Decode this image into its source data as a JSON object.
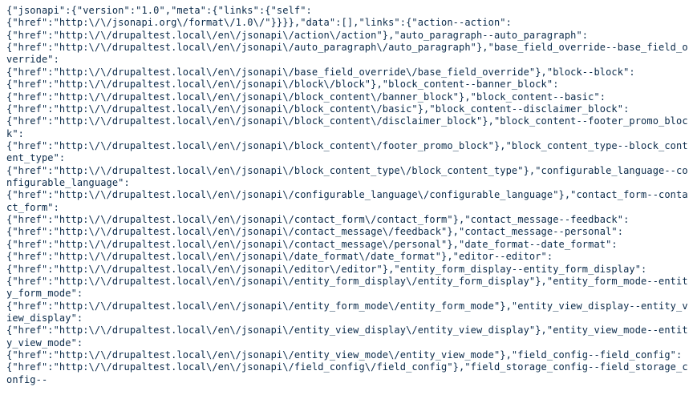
{
  "json_response": {
    "jsonapi": {
      "version": "1.0",
      "meta": {
        "links": {
          "self": {
            "href": "http://jsonapi.org/format/1.0/"
          }
        }
      }
    },
    "data": [],
    "links": {
      "action--action": {
        "href": "http://drupaltest.local/en/jsonapi/action/action"
      },
      "auto_paragraph--auto_paragraph": {
        "href": "http://drupaltest.local/en/jsonapi/auto_paragraph/auto_paragraph"
      },
      "base_field_override--base_field_override": {
        "href": "http://drupaltest.local/en/jsonapi/base_field_override/base_field_override"
      },
      "block--block": {
        "href": "http://drupaltest.local/en/jsonapi/block/block"
      },
      "block_content--banner_block": {
        "href": "http://drupaltest.local/en/jsonapi/block_content/banner_block"
      },
      "block_content--basic": {
        "href": "http://drupaltest.local/en/jsonapi/block_content/basic"
      },
      "block_content--disclaimer_block": {
        "href": "http://drupaltest.local/en/jsonapi/block_content/disclaimer_block"
      },
      "block_content--footer_promo_block": {
        "href": "http://drupaltest.local/en/jsonapi/block_content/footer_promo_block"
      },
      "block_content_type--block_content_type": {
        "href": "http://drupaltest.local/en/jsonapi/block_content_type/block_content_type"
      },
      "configurable_language--configurable_language": {
        "href": "http://drupaltest.local/en/jsonapi/configurable_language/configurable_language"
      },
      "contact_form--contact_form": {
        "href": "http://drupaltest.local/en/jsonapi/contact_form/contact_form"
      },
      "contact_message--feedback": {
        "href": "http://drupaltest.local/en/jsonapi/contact_message/feedback"
      },
      "contact_message--personal": {
        "href": "http://drupaltest.local/en/jsonapi/contact_message/personal"
      },
      "date_format--date_format": {
        "href": "http://drupaltest.local/en/jsonapi/date_format/date_format"
      },
      "editor--editor": {
        "href": "http://drupaltest.local/en/jsonapi/editor/editor"
      },
      "entity_form_display--entity_form_display": {
        "href": "http://drupaltest.local/en/jsonapi/entity_form_display/entity_form_display"
      },
      "entity_form_mode--entity_form_mode": {
        "href": "http://drupaltest.local/en/jsonapi/entity_form_mode/entity_form_mode"
      },
      "entity_view_display--entity_view_display": {
        "href": "http://drupaltest.local/en/jsonapi/entity_view_display/entity_view_display"
      },
      "entity_view_mode--entity_view_mode": {
        "href": "http://drupaltest.local/en/jsonapi/entity_view_mode/entity_view_mode"
      },
      "field_config--field_config": {
        "href": "http://drupaltest.local/en/jsonapi/field_config/field_config"
      },
      "field_storage_config--field_storage_config": ""
    }
  },
  "render": {
    "esc_slash": "\\/",
    "truncate_tail": "field_storage_config\":"
  }
}
